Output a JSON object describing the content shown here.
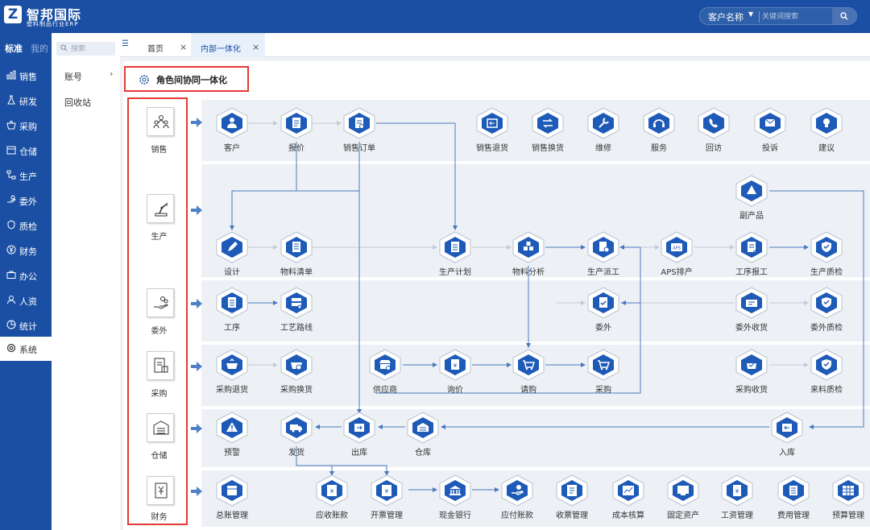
{
  "header": {
    "logo_letter": "Z",
    "brand": "智邦国际",
    "tagline": "塑料制品行业ERP",
    "customer_select": "客户名称",
    "search_placeholder": "关键词搜索"
  },
  "sidebar": {
    "tab_standard": "标准",
    "tab_mine": "我的",
    "items": [
      "销售",
      "研发",
      "采购",
      "仓储",
      "生产",
      "委外",
      "质检",
      "财务",
      "办公",
      "人资",
      "统计",
      "系统"
    ],
    "selected": "系统"
  },
  "submenu": {
    "search_placeholder": "搜索",
    "items": [
      "账号",
      "回收站"
    ]
  },
  "tabs": [
    "首页",
    "内部一体化"
  ],
  "panel_title": "角色间协同一体化",
  "roles": [
    "销售",
    "生产",
    "委外",
    "采购",
    "仓储",
    "财务"
  ],
  "nodes": {
    "kehu": "客户",
    "baojia": "报价",
    "xsdd": "销售订单",
    "xsth": "销售退货",
    "xshh": "销售换货",
    "weixiu": "维修",
    "fuwu": "服务",
    "huifang": "回访",
    "tousu": "投诉",
    "jianyi": "建议",
    "fuchanpin": "副产品",
    "sheji": "设计",
    "wlqd": "物料清单",
    "scjh": "生产计划",
    "wlfx": "物料分析",
    "scpg": "生产派工",
    "aps": "APS排产",
    "gxbg": "工序报工",
    "sczj": "生产质检",
    "gongxu": "工序",
    "gylx": "工艺路线",
    "weiwai": "委外",
    "wwsh": "委外收货",
    "wwzj": "委外质检",
    "cgth": "采购退货",
    "cghh": "采购换货",
    "gys": "供应商",
    "xunjia": "询价",
    "qinggou": "请购",
    "caigou": "采购",
    "cgsh": "采购收货",
    "lljz": "来料质检",
    "yujing": "预警",
    "fahuo": "发货",
    "chuku": "出库",
    "cangku": "仓库",
    "ruku": "入库",
    "zzgl": "总账管理",
    "yszk": "应收账款",
    "kpgl": "开票管理",
    "xjyh": "现金银行",
    "yfzk": "应付账款",
    "spgl": "收票管理",
    "cbhs": "成本核算",
    "gdzc": "固定资产",
    "gzgl": "工资管理",
    "fygl": "费用管理",
    "ysgl": "预算管理"
  },
  "colors": {
    "header_blue": "#1a4fa3",
    "highlight_red": "#e53935",
    "node_blue": "#1e5bb8",
    "band_bg": "#edf1f6"
  }
}
